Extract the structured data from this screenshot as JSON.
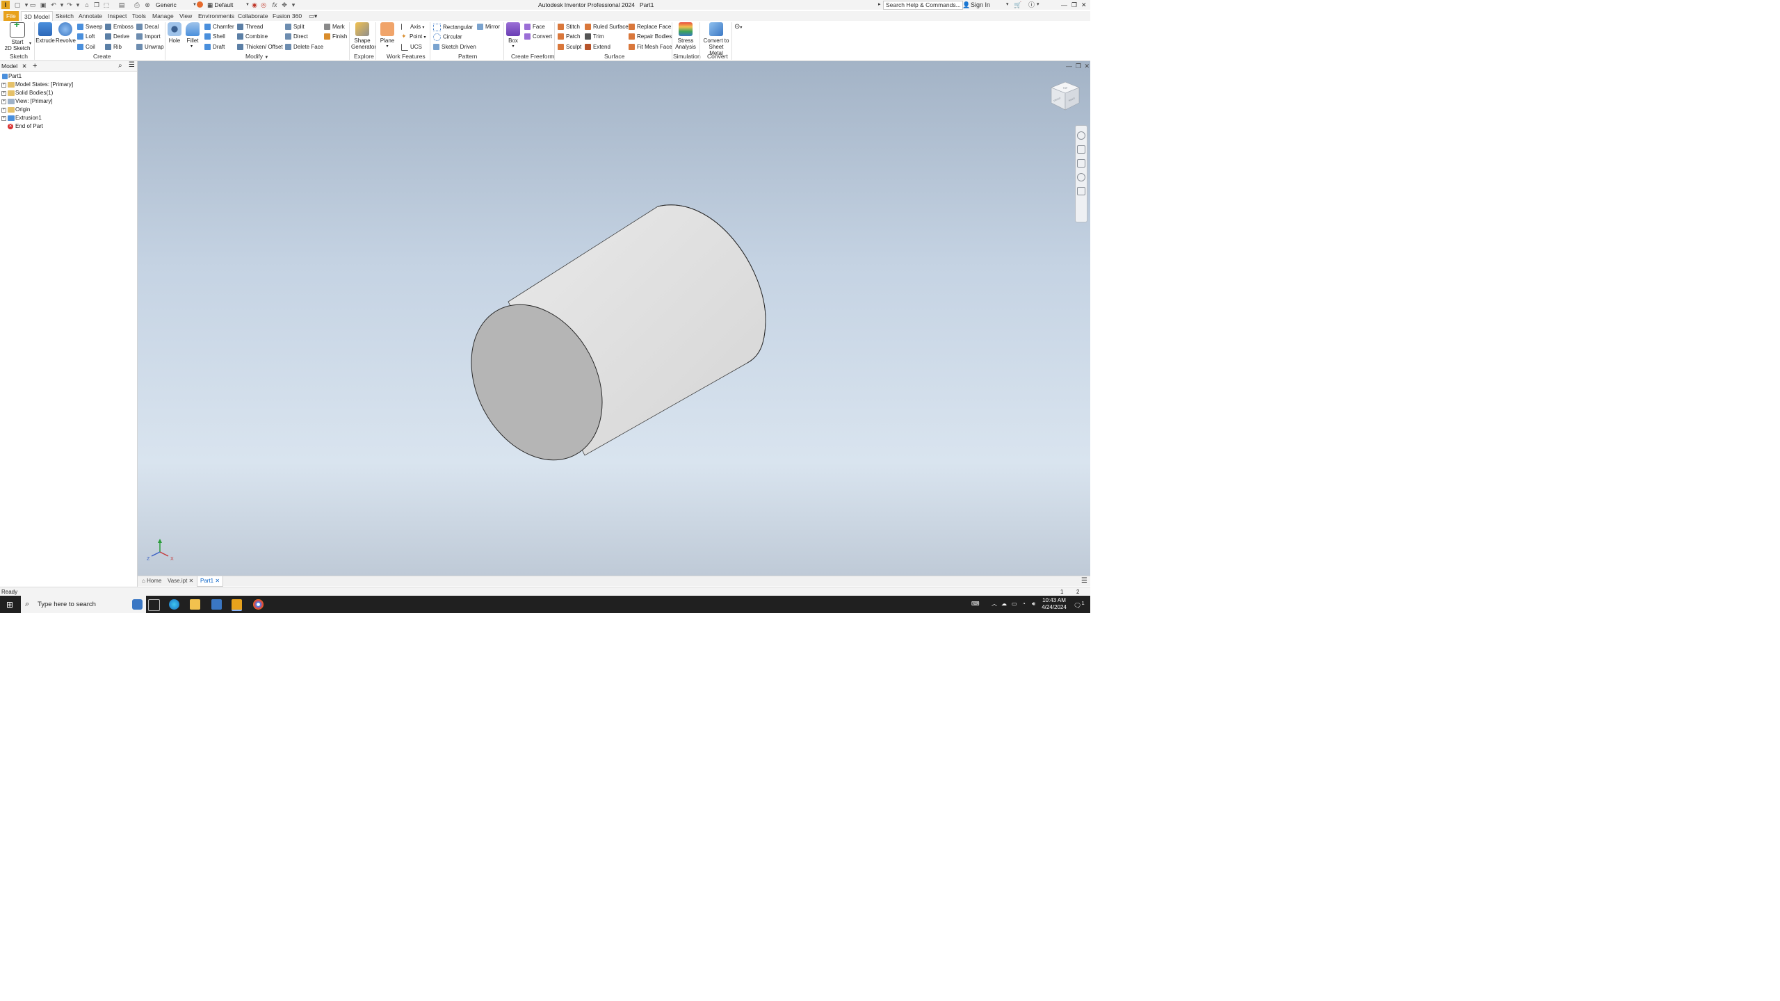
{
  "titlebar": {
    "app_logo": "I",
    "material_combo": "Generic",
    "appearance_combo": "Default",
    "window_title": "Autodesk Inventor Professional 2024",
    "document_name": "Part1",
    "search_placeholder": "Search Help & Commands...",
    "sign_in": "Sign In"
  },
  "tabs": [
    "File",
    "3D Model",
    "Sketch",
    "Annotate",
    "Inspect",
    "Tools",
    "Manage",
    "View",
    "Environments",
    "Collaborate",
    "Fusion 360"
  ],
  "ribbon": {
    "sketch": {
      "label": "Sketch",
      "start_sketch": "Start\n2D Sketch"
    },
    "create": {
      "label": "Create",
      "extrude": "Extrude",
      "revolve": "Revolve",
      "sweep": "Sweep",
      "loft": "Loft",
      "coil": "Coil",
      "emboss": "Emboss",
      "derive": "Derive",
      "rib": "Rib",
      "decal": "Decal",
      "import": "Import",
      "unwrap": "Unwrap"
    },
    "modify": {
      "label": "Modify",
      "hole": "Hole",
      "fillet": "Fillet",
      "chamfer": "Chamfer",
      "shell": "Shell",
      "draft": "Draft",
      "thread": "Thread",
      "combine": "Combine",
      "thicken": "Thicken/ Offset",
      "split": "Split",
      "direct": "Direct",
      "delete_face": "Delete Face",
      "mark": "Mark",
      "finish": "Finish"
    },
    "explore": {
      "label": "Explore",
      "shape_generator": "Shape\nGenerator"
    },
    "work_features": {
      "label": "Work Features",
      "plane": "Plane",
      "axis": "Axis",
      "point": "Point",
      "ucs": "UCS"
    },
    "pattern": {
      "label": "Pattern",
      "rectangular": "Rectangular",
      "circular": "Circular",
      "sketch_driven": "Sketch Driven",
      "mirror": "Mirror"
    },
    "create_freeform": {
      "label": "Create Freeform",
      "box": "Box",
      "face": "Face",
      "convert": "Convert"
    },
    "surface": {
      "label": "Surface",
      "stitch": "Stitch",
      "patch": "Patch",
      "sculpt": "Sculpt",
      "ruled_surface": "Ruled Surface",
      "trim": "Trim",
      "extend": "Extend",
      "replace_face": "Replace Face",
      "repair_bodies": "Repair Bodies",
      "fit_mesh_face": "Fit Mesh Face"
    },
    "simulation": {
      "label": "Simulation",
      "stress_analysis": "Stress\nAnalysis"
    },
    "convert": {
      "label": "Convert",
      "convert_sheet_metal": "Convert to\nSheet Metal"
    }
  },
  "browser": {
    "tab": "Model",
    "items": [
      {
        "label": "Part1",
        "expandable": false
      },
      {
        "label": "Model States: [Primary]",
        "expandable": true
      },
      {
        "label": "Solid Bodies(1)",
        "expandable": true
      },
      {
        "label": "View: [Primary]",
        "expandable": true
      },
      {
        "label": "Origin",
        "expandable": true
      },
      {
        "label": "Extrusion1",
        "expandable": true
      },
      {
        "label": "End of Part",
        "expandable": false
      }
    ]
  },
  "viewcube": {
    "top": "TOP",
    "front": "FRONT",
    "right": "RIGHT"
  },
  "triad": {
    "x": "X",
    "y": "Y",
    "z": "Z"
  },
  "doctabs": {
    "home": "Home",
    "vase": "Vase.ipt",
    "part1": "Part1"
  },
  "status": {
    "text": "Ready",
    "num1": "1",
    "num2": "2"
  },
  "taskbar": {
    "search": "Type here to search",
    "time": "10:43 AM",
    "date": "4/24/2024",
    "notifications": "1"
  },
  "colors": {
    "accent": "#e8a21c",
    "file_tab": "#e8a21c",
    "cylinder_side": "#e2e2e2",
    "cylinder_cap": "#b5b5b5"
  }
}
